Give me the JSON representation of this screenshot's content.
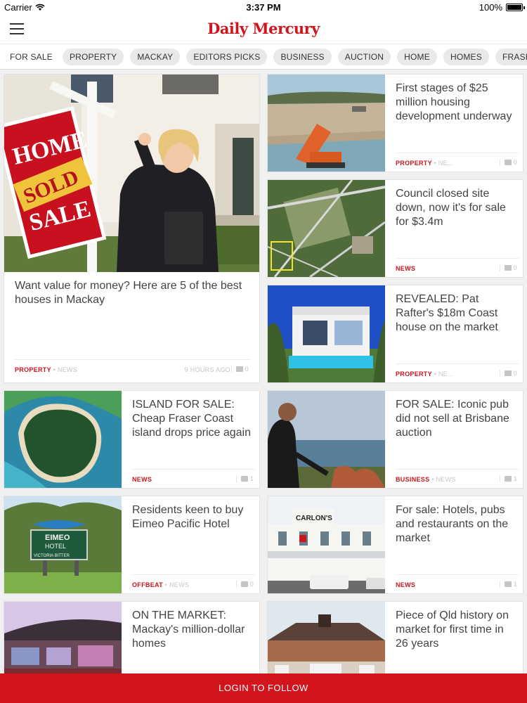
{
  "status_bar": {
    "carrier": "Carrier",
    "time": "3:37 PM",
    "battery": "100%"
  },
  "header": {
    "logo": "Daily Mercury",
    "menu_icon": "hamburger-menu-icon"
  },
  "tabs": [
    "FOR SALE",
    "PROPERTY",
    "MACKAY",
    "EDITORS PICKS",
    "BUSINESS",
    "AUCTION",
    "HOME",
    "HOMES",
    "FRASER COAST"
  ],
  "articles": [
    {
      "headline": "Want value for money? Here are 5 of the best houses in Mackay",
      "category": "PROPERTY",
      "sub": "• NEWS",
      "time": "9 HOURS AGO",
      "comments": "0",
      "image": "Woman holding keys beside a red home sold sign"
    },
    {
      "headline": "First stages of $25 million housing development underway",
      "category": "PROPERTY",
      "sub": "• NE...",
      "comments": "0"
    },
    {
      "headline": "Council closed site down, now it's for sale for $3.4m",
      "category": "NEWS",
      "sub": "",
      "comments": "0"
    },
    {
      "headline": "REVEALED: Pat Rafter's $18m Coast house on the market",
      "category": "PROPERTY",
      "sub": "• NE...",
      "comments": "0"
    },
    {
      "headline": "ISLAND FOR SALE: Cheap Fraser Coast island drops price again",
      "category": "NEWS",
      "sub": "",
      "comments": "1"
    },
    {
      "headline": "FOR SALE: Iconic pub did not sell at Brisbane auction",
      "category": "BUSINESS",
      "sub": "• NEWS",
      "comments": "1"
    },
    {
      "headline": "Residents keen to buy Eimeo Pacific Hotel",
      "category": "OFFBEAT",
      "sub": "• NEWS",
      "comments": "0"
    },
    {
      "headline": "For sale: Hotels, pubs and restaurants on the market",
      "category": "NEWS",
      "sub": "",
      "comments": "1"
    },
    {
      "headline": "ON THE MARKET: Mackay's million-dollar homes",
      "category": "",
      "sub": "",
      "comments": ""
    },
    {
      "headline": "Piece of Qld history on market for first time in 26 years",
      "category": "",
      "sub": "",
      "comments": ""
    }
  ],
  "sign_text": {
    "line1": "HOME",
    "sold": "SOLD",
    "line2": "SALE",
    "hotel": "EIMEO",
    "hotel2": "HOTEL",
    "pub": "CARLON'S",
    "beer": "VICTORIA BITTER"
  },
  "login": "LOGIN TO FOLLOW",
  "colors": {
    "brand": "#d2141c",
    "category": "#c8161e"
  }
}
